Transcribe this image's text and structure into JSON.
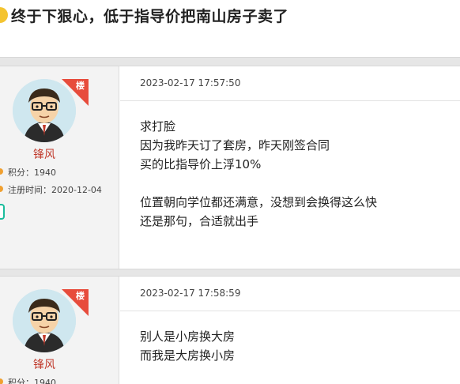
{
  "thread": {
    "title": "终于下狠心，低于指导价把南山房子卖了"
  },
  "posts": [
    {
      "floor_badge": "楼",
      "username": "锋风",
      "points_label": "积分：",
      "points_value": "1940",
      "registered_label": "注册时间：",
      "registered_value": "2020-12-04",
      "timestamp": "2023-02-17 17:57:50",
      "lines": [
        "求打脸",
        "因为我昨天订了套房，昨天刚签合同",
        "买的比指导价上浮10%",
        "",
        "位置朝向学位都还满意，没想到会换得这么快",
        "还是那句，合适就出手"
      ]
    },
    {
      "floor_badge": "楼",
      "username": "锋风",
      "points_label": "积分：",
      "points_value": "1940",
      "timestamp": "2023-02-17 17:58:59",
      "lines": [
        "别人是小房换大房",
        "而我是大房换小房"
      ]
    }
  ],
  "colors": {
    "username": "#c0392b",
    "floor_badge": "#e74c3c",
    "title_dot": "#f4c430",
    "tag_green": "#1abc9c"
  }
}
